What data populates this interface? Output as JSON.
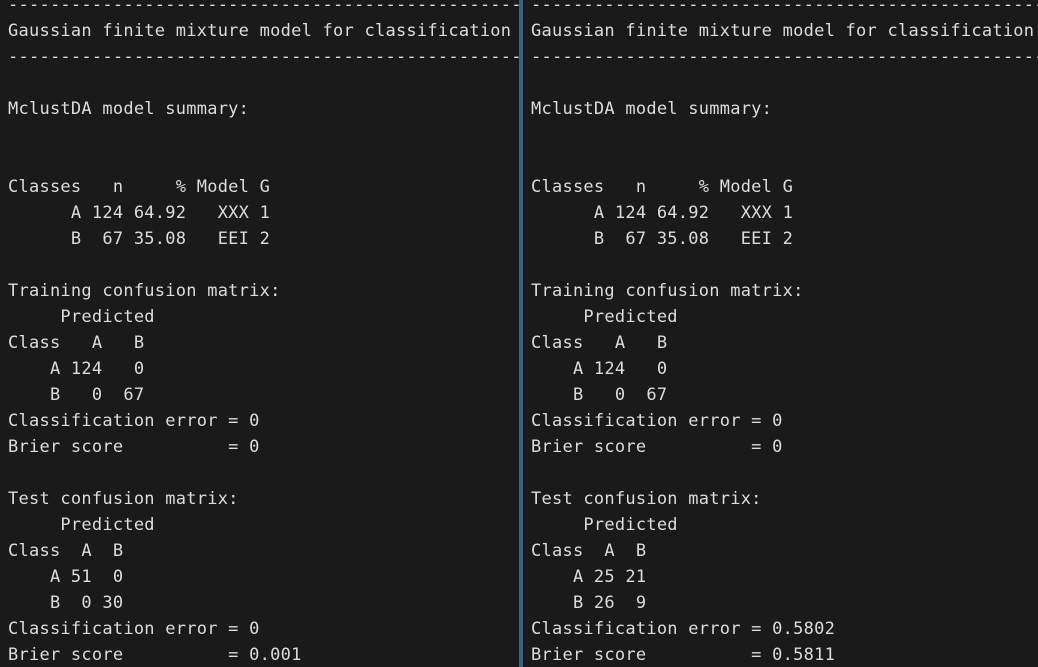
{
  "panes": [
    {
      "lines": [
        "---------------------------------------------------",
        "Gaussian finite mixture model for classification",
        "---------------------------------------------------",
        "",
        "MclustDA model summary:",
        "",
        "",
        "Classes   n     % Model G",
        "      A 124 64.92   XXX 1",
        "      B  67 35.08   EEI 2",
        "",
        "Training confusion matrix:",
        "     Predicted",
        "Class   A   B",
        "    A 124   0",
        "    B   0  67",
        "Classification error = 0",
        "Brier score          = 0",
        "",
        "Test confusion matrix:",
        "     Predicted",
        "Class  A  B",
        "    A 51  0",
        "    B  0 30",
        "Classification error = 0",
        "Brier score          = 0.001"
      ]
    },
    {
      "lines": [
        "---------------------------------------------------",
        "Gaussian finite mixture model for classification",
        "---------------------------------------------------",
        "",
        "MclustDA model summary:",
        "",
        "",
        "Classes   n     % Model G",
        "      A 124 64.92   XXX 1",
        "      B  67 35.08   EEI 2",
        "",
        "Training confusion matrix:",
        "     Predicted",
        "Class   A   B",
        "    A 124   0",
        "    B   0  67",
        "Classification error = 0",
        "Brier score          = 0",
        "",
        "Test confusion matrix:",
        "     Predicted",
        "Class  A  B",
        "    A 25 21",
        "    B 26  9",
        "Classification error = 0.5802",
        "Brier score          = 0.5811"
      ]
    }
  ],
  "colors": {
    "background": "#1a1a1a",
    "text": "#dcdcdc",
    "divider": "#3f5f7f"
  }
}
